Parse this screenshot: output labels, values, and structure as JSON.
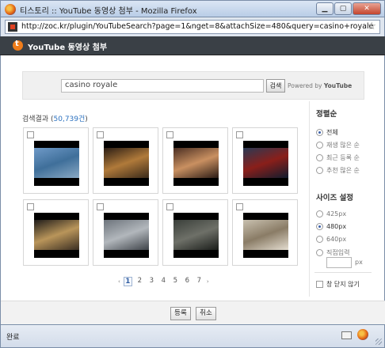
{
  "window": {
    "title": "티스토리 :: YouTube 동영상 첨부 - Mozilla Firefox",
    "url": "http://zoc.kr/plugin/YouTubeSearch?page=1&nget=8&attachSize=480&query=casino+royale",
    "min_glyph": "▁",
    "max_glyph": "▢",
    "close_glyph": "✕",
    "star_glyph": "☆"
  },
  "app": {
    "header_title": "YouTube 동영상 첨부"
  },
  "search": {
    "query": "casino royale",
    "button_label": "검색",
    "powered_prefix": "Powered by ",
    "powered_brand": "YouTube"
  },
  "results": {
    "label": "검색결과 (",
    "count": "50,739건",
    "suffix": ")"
  },
  "videos": [
    {
      "colors": [
        "#6f9ac8",
        "#3f6f9a",
        "#8aa9c4"
      ]
    },
    {
      "colors": [
        "#2a1d14",
        "#b07a3a",
        "#3a2a1a"
      ]
    },
    {
      "colors": [
        "#4a2e22",
        "#c99061",
        "#2b1c16"
      ]
    },
    {
      "colors": [
        "#2a3a55",
        "#8a1f1a",
        "#101c2e"
      ]
    },
    {
      "colors": [
        "#1f1c1a",
        "#b9955a",
        "#3a2e22"
      ]
    },
    {
      "colors": [
        "#6d747c",
        "#b2b7bc",
        "#3e4349"
      ]
    },
    {
      "colors": [
        "#3a3f3a",
        "#6e7068",
        "#1a1d1a"
      ]
    },
    {
      "colors": [
        "#c9c1b0",
        "#8a7c66",
        "#e4ddd0"
      ]
    }
  ],
  "pager": {
    "prev": "‹",
    "next": "›",
    "pages": [
      "1",
      "2",
      "3",
      "4",
      "5",
      "6",
      "7"
    ],
    "current": "1"
  },
  "sidebar": {
    "sort_heading": "정렬순",
    "sort_options": [
      "전체",
      "재생 많은 순",
      "최근 등록 순",
      "추천 많은 순"
    ],
    "sort_selected": 0,
    "size_heading": "사이즈 설정",
    "size_options": [
      "425px",
      "480px",
      "640px",
      "직접입력"
    ],
    "size_selected": 1,
    "px_unit": "px",
    "window_close_label": "창 닫지 않기"
  },
  "footer": {
    "register_label": "등록",
    "cancel_label": "취소"
  },
  "status": {
    "text": "완료"
  }
}
